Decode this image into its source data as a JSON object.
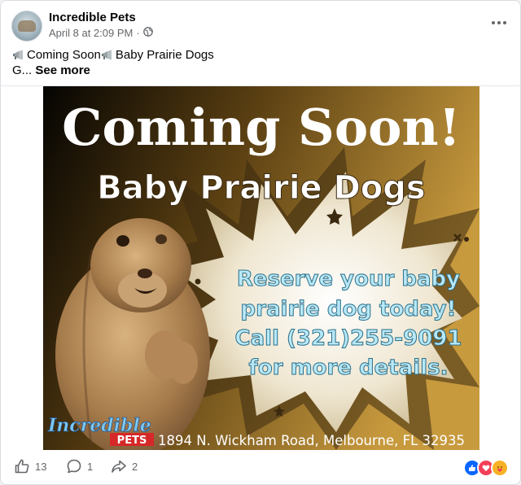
{
  "post": {
    "page_name": "Incredible Pets",
    "timestamp": "April 8 at 2:09 PM",
    "separator": "·",
    "text_line1_part1": "Coming Soon",
    "text_line1_part2": "Baby Prairie Dogs",
    "text_line2": "G...",
    "see_more": "See more"
  },
  "image": {
    "headline": "Coming Soon!",
    "subheadline": "Baby Prairie Dogs",
    "body_lines": [
      "Reserve your baby",
      "prairie dog today!",
      "Call (321)255-9091",
      "for more details."
    ],
    "logo_word": "Incredible",
    "logo_sub": "PETS",
    "address": "1894 N. Wickham Road, Melbourne, FL 32935"
  },
  "actions": {
    "likes": "13",
    "comments": "1",
    "shares": "2"
  },
  "colors": {
    "facebook_blue": "#0866ff",
    "love_red": "#f33e58",
    "care_yellow": "#f7b125",
    "text_primary": "#050505",
    "text_secondary": "#65676b"
  }
}
